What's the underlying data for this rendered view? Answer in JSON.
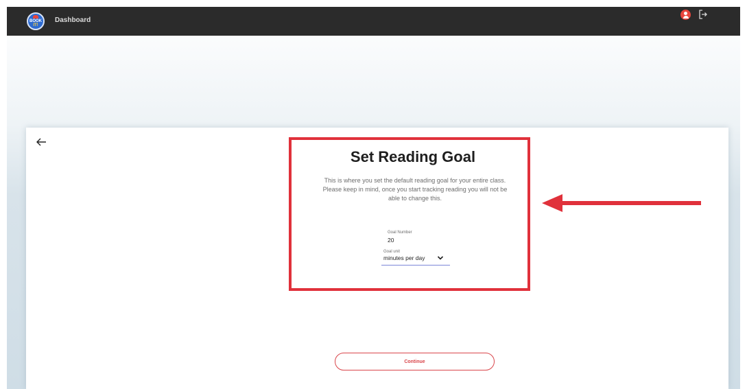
{
  "header": {
    "logo": {
      "line1": "BOOK",
      "line2": "IT!"
    },
    "nav_label": "Dashboard",
    "avatar_icon": "user-avatar-icon",
    "logout_icon": "logout-icon"
  },
  "page": {
    "back_icon": "arrow-left-icon",
    "title": "Set Reading Goal",
    "description": "This is where you set the default reading goal for your entire class. Please keep in mind, once you start tracking reading you will not be able to change this.",
    "goal_number": {
      "label": "Goal Number",
      "value": "20"
    },
    "goal_unit": {
      "label": "Goal unit",
      "value": "minutes per day",
      "icon": "chevron-down-icon"
    },
    "continue_label": "Continue"
  },
  "annotations": {
    "highlight_color": "#e0313b",
    "arrow_icon": "arrow-left-annotation-icon"
  },
  "colors": {
    "topbar": "#2b2b2b",
    "accent": "#d9454a",
    "underline": "#7b86d8"
  }
}
